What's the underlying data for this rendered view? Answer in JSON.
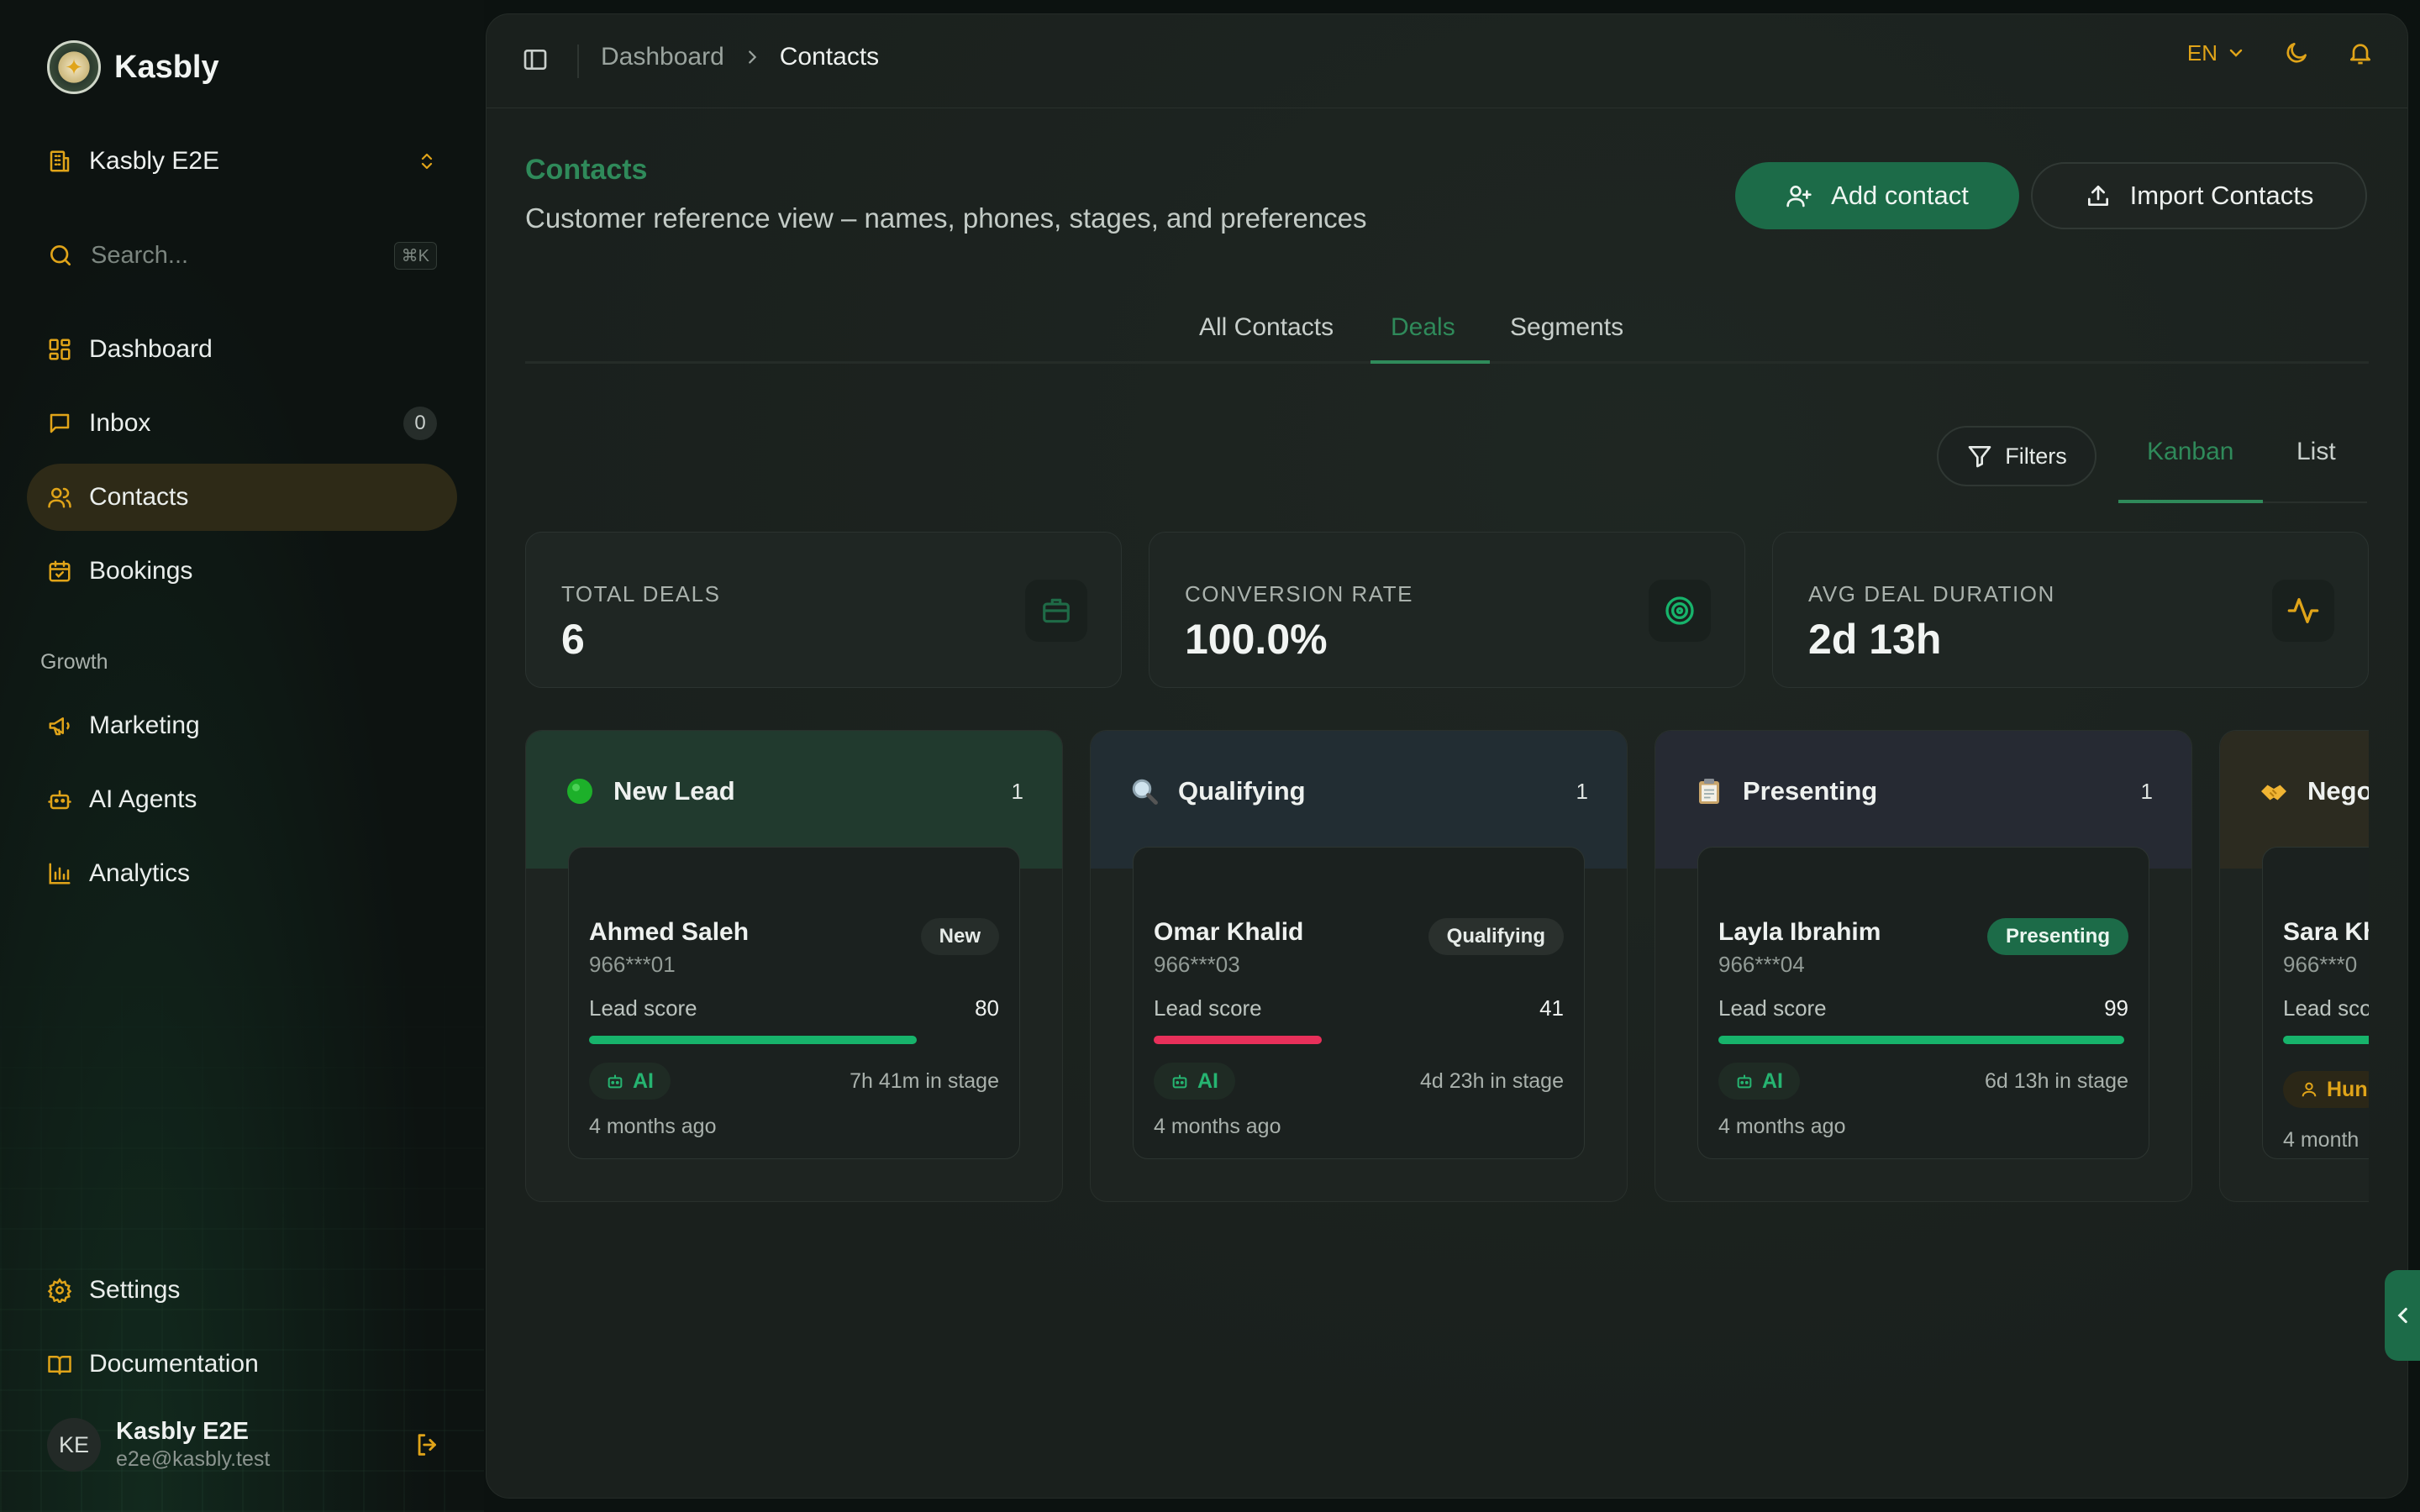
{
  "brand": {
    "name": "Kasbly"
  },
  "workspace": {
    "name": "Kasbly E2E"
  },
  "search": {
    "placeholder": "Search...",
    "shortcut": "⌘K"
  },
  "nav": {
    "items": [
      {
        "label": "Dashboard",
        "icon": "dashboard-icon"
      },
      {
        "label": "Inbox",
        "icon": "message-icon",
        "count": "0"
      },
      {
        "label": "Contacts",
        "icon": "users-icon",
        "active": true
      },
      {
        "label": "Bookings",
        "icon": "calendar-icon"
      }
    ],
    "growth_title": "Growth",
    "growth_items": [
      {
        "label": "Marketing",
        "icon": "megaphone-icon"
      },
      {
        "label": "AI Agents",
        "icon": "robot-icon"
      },
      {
        "label": "Analytics",
        "icon": "bar-chart-icon"
      }
    ],
    "footer_items": [
      {
        "label": "Settings",
        "icon": "gear-icon"
      },
      {
        "label": "Documentation",
        "icon": "book-icon"
      }
    ]
  },
  "user": {
    "initials": "KE",
    "name": "Kasbly E2E",
    "email": "e2e@kasbly.test"
  },
  "topbar": {
    "breadcrumb": [
      "Dashboard",
      "Contacts"
    ],
    "language": "EN"
  },
  "page": {
    "title": "Contacts",
    "subtitle": "Customer reference view – names, phones, stages, and preferences",
    "add_contact_label": "Add contact",
    "import_contacts_label": "Import Contacts"
  },
  "tabs": [
    {
      "label": "All Contacts",
      "active": false
    },
    {
      "label": "Deals",
      "active": true
    },
    {
      "label": "Segments",
      "active": false
    }
  ],
  "toolbar": {
    "filters_label": "Filters",
    "views": [
      {
        "label": "Kanban",
        "active": true
      },
      {
        "label": "List",
        "active": false
      }
    ]
  },
  "stats": [
    {
      "label": "TOTAL DEALS",
      "value": "6",
      "icon": "briefcase-icon"
    },
    {
      "label": "CONVERSION RATE",
      "value": "100.0%",
      "icon": "target-icon"
    },
    {
      "label": "AVG DEAL DURATION",
      "value": "2d 13h",
      "icon": "activity-icon"
    }
  ],
  "columns": [
    {
      "title": "New Lead",
      "emoji": "🟢",
      "count": "1",
      "card": {
        "name": "Ahmed Saleh",
        "phone": "966***01",
        "stage": "New",
        "score_label": "Lead score",
        "score": "80",
        "score_pct": 80,
        "agent": "AI",
        "time_in_stage": "7h 41m in stage",
        "age": "4 months ago"
      }
    },
    {
      "title": "Qualifying",
      "emoji": "🔍",
      "count": "1",
      "card": {
        "name": "Omar Khalid",
        "phone": "966***03",
        "stage": "Qualifying",
        "score_label": "Lead score",
        "score": "41",
        "score_pct": 41,
        "agent": "AI",
        "time_in_stage": "4d 23h in stage",
        "age": "4 months ago"
      }
    },
    {
      "title": "Presenting",
      "emoji": "📋",
      "count": "1",
      "card": {
        "name": "Layla Ibrahim",
        "phone": "966***04",
        "stage": "Presenting",
        "score_label": "Lead score",
        "score": "99",
        "score_pct": 99,
        "agent": "AI",
        "time_in_stage": "6d 13h in stage",
        "age": "4 months ago"
      }
    },
    {
      "title": "Nego",
      "emoji": "🤝",
      "count": "",
      "card": {
        "name": "Sara Kh",
        "phone": "966***0",
        "stage": "",
        "score_label": "Lead sco",
        "score": "",
        "score_pct": 100,
        "agent": "Hun",
        "time_in_stage": "",
        "age": "4 month"
      }
    }
  ],
  "colors": {
    "accent": "#2f8a5a",
    "primary_button": "#1c6b48",
    "gold": "#e0a419",
    "score_high": "#17b36b",
    "score_low": "#e8305a"
  }
}
